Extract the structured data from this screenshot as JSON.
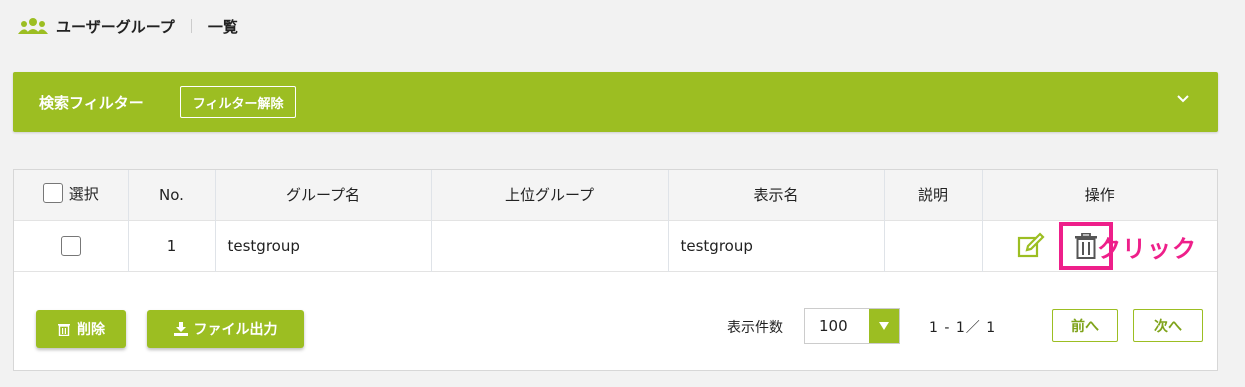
{
  "header": {
    "title": "ユーザーグループ",
    "subtitle": "一覧",
    "icon": "users-icon"
  },
  "filter": {
    "title": "検索フィルター",
    "clear_button": "フィルター解除",
    "toggle_icon": "chevron-down-icon"
  },
  "table": {
    "headers": {
      "select": "選択",
      "no": "No.",
      "group_name": "グループ名",
      "parent_group": "上位グループ",
      "display_name": "表示名",
      "description": "説明",
      "operations": "操作"
    },
    "rows": [
      {
        "no": "1",
        "group_name": "testgroup",
        "parent_group": "",
        "display_name": "testgroup",
        "description": ""
      }
    ]
  },
  "annotation": {
    "click_label": "クリック",
    "highlight_color": "#ee1f8a"
  },
  "footer": {
    "delete_button": "削除",
    "export_button": "ファイル出力",
    "per_page_label": "表示件数",
    "per_page_value": "100",
    "range_text": "1 - 1／ 1",
    "prev_button": "前へ",
    "next_button": "次へ"
  },
  "colors": {
    "accent": "#9cbe22",
    "background": "#f2f2f2"
  }
}
